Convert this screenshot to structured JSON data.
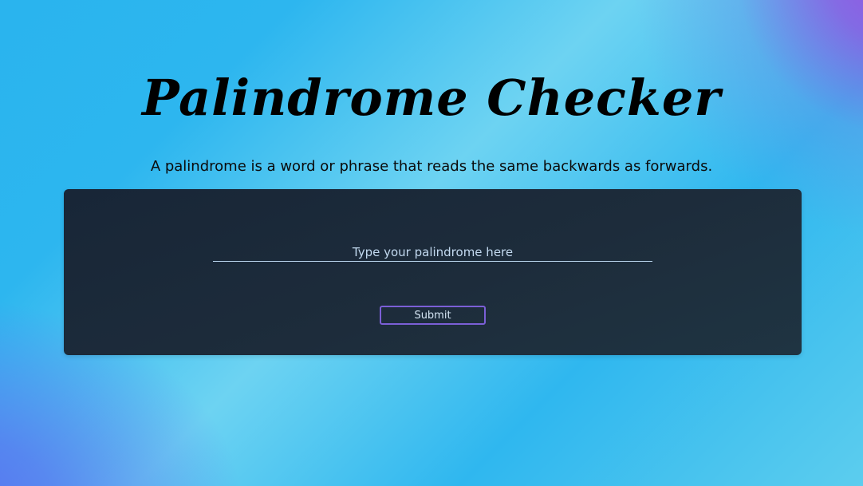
{
  "header": {
    "title": "Palindrome Checker",
    "description": "A palindrome is a word or phrase that reads the same backwards as forwards."
  },
  "form": {
    "input_value": "",
    "input_placeholder": "Type your palindrome here",
    "submit_label": "Submit"
  },
  "colors": {
    "background_primary": "#2db6ef",
    "background_accent_purple": "#9a4fe0",
    "card_background": "#1c2b3a",
    "button_border": "#7b5fd6"
  }
}
